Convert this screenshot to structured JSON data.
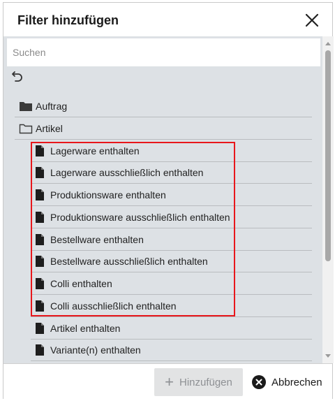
{
  "dialog": {
    "title": "Filter hinzufügen",
    "close_icon": "close-icon"
  },
  "search": {
    "placeholder": "Suchen",
    "value": ""
  },
  "undo_icon": "undo-icon",
  "tree": {
    "groups": [
      {
        "label": "Auftrag",
        "icon": "folder-filled-icon"
      },
      {
        "label": "Artikel",
        "icon": "folder-open-icon"
      }
    ],
    "items": [
      {
        "label": "Lagerware enthalten",
        "icon": "document-icon"
      },
      {
        "label": "Lagerware ausschließlich enthalten",
        "icon": "document-icon"
      },
      {
        "label": "Produktionsware enthalten",
        "icon": "document-icon"
      },
      {
        "label": "Produktionsware ausschließlich enthalten",
        "icon": "document-icon"
      },
      {
        "label": "Bestellware enthalten",
        "icon": "document-icon"
      },
      {
        "label": "Bestellware ausschließlich enthalten",
        "icon": "document-icon"
      },
      {
        "label": "Colli enthalten",
        "icon": "document-icon"
      },
      {
        "label": "Colli ausschließlich enthalten",
        "icon": "document-icon"
      },
      {
        "label": "Artikel enthalten",
        "icon": "document-icon"
      },
      {
        "label": "Variante(n) enthalten",
        "icon": "document-icon"
      }
    ]
  },
  "footer": {
    "add_label": "Hinzufügen",
    "cancel_label": "Abbrechen"
  },
  "colors": {
    "highlight": "#e8161b",
    "content_bg": "#dde1e5",
    "disabled_button_bg": "#e2e3e4"
  }
}
